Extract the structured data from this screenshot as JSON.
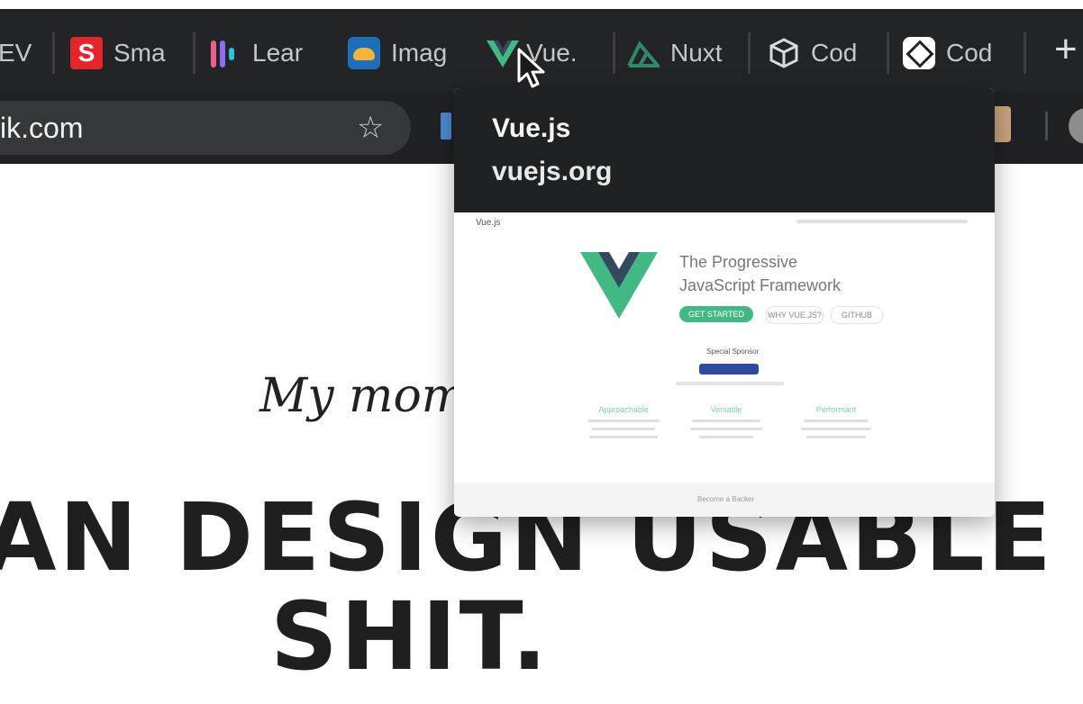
{
  "bookmarks": [
    {
      "label": "EV",
      "icon": "bookmark-icon"
    },
    {
      "label": "Sma",
      "icon": "smashing-magazine-icon"
    },
    {
      "label": "Lear",
      "icon": "learn-icon"
    },
    {
      "label": "Imag",
      "icon": "image-cloud-icon"
    },
    {
      "label": "Vue.",
      "icon": "vue-logo-icon"
    },
    {
      "label": "Nuxt",
      "icon": "nuxt-logo-icon"
    },
    {
      "label": "Cod",
      "icon": "codesandbox-icon"
    },
    {
      "label": "Cod",
      "icon": "codepen-icon"
    }
  ],
  "new_tab_label": "+",
  "address_bar": {
    "url": "ik.com"
  },
  "hover_card": {
    "title": "Vue.js",
    "url": "vuejs.org",
    "preview": {
      "site_name": "Vue.js",
      "headline_line1": "The Progressive",
      "headline_line2": "JavaScript Framework",
      "get_started": "GET STARTED",
      "why_vue": "WHY VUE.JS?",
      "github": "GITHUB",
      "special_sponsor": "Special Sponsor",
      "features": [
        "Approachable",
        "Versatile",
        "Performant"
      ],
      "footer": "Become a Backer"
    }
  },
  "page": {
    "tagline": "My mom",
    "headline_line1": "AN DESIGN USABLE",
    "headline_line2": "SHIT."
  },
  "colors": {
    "chrome_dark": "#202124",
    "vue_green": "#42b883",
    "vue_dark": "#35495e",
    "headline": "#1f1f1f"
  }
}
